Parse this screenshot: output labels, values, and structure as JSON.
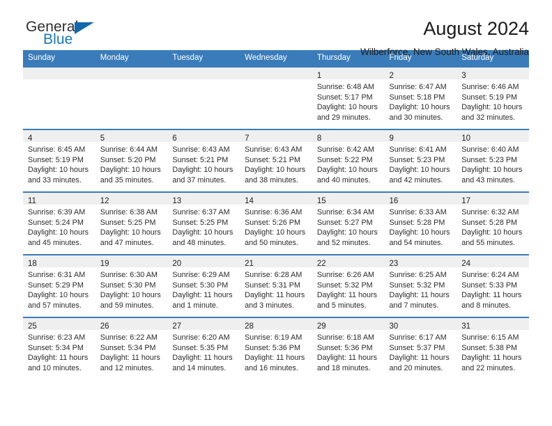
{
  "brand": {
    "name_part1": "General",
    "name_part2": "Blue",
    "accent_color": "#1268ae",
    "text_color": "#2e2e2e"
  },
  "header": {
    "title": "August 2024",
    "subtitle": "Wilberforce, New South Wales, Australia"
  },
  "calendar": {
    "header_bg": "#3a7cba",
    "daynum_bg": "#efefef",
    "weekdays": [
      "Sunday",
      "Monday",
      "Tuesday",
      "Wednesday",
      "Thursday",
      "Friday",
      "Saturday"
    ],
    "weeks": [
      [
        {
          "day": "",
          "sunrise": "",
          "sunset": "",
          "daylight1": "",
          "daylight2": ""
        },
        {
          "day": "",
          "sunrise": "",
          "sunset": "",
          "daylight1": "",
          "daylight2": ""
        },
        {
          "day": "",
          "sunrise": "",
          "sunset": "",
          "daylight1": "",
          "daylight2": ""
        },
        {
          "day": "",
          "sunrise": "",
          "sunset": "",
          "daylight1": "",
          "daylight2": ""
        },
        {
          "day": "1",
          "sunrise": "Sunrise: 6:48 AM",
          "sunset": "Sunset: 5:17 PM",
          "daylight1": "Daylight: 10 hours",
          "daylight2": "and 29 minutes."
        },
        {
          "day": "2",
          "sunrise": "Sunrise: 6:47 AM",
          "sunset": "Sunset: 5:18 PM",
          "daylight1": "Daylight: 10 hours",
          "daylight2": "and 30 minutes."
        },
        {
          "day": "3",
          "sunrise": "Sunrise: 6:46 AM",
          "sunset": "Sunset: 5:19 PM",
          "daylight1": "Daylight: 10 hours",
          "daylight2": "and 32 minutes."
        }
      ],
      [
        {
          "day": "4",
          "sunrise": "Sunrise: 6:45 AM",
          "sunset": "Sunset: 5:19 PM",
          "daylight1": "Daylight: 10 hours",
          "daylight2": "and 33 minutes."
        },
        {
          "day": "5",
          "sunrise": "Sunrise: 6:44 AM",
          "sunset": "Sunset: 5:20 PM",
          "daylight1": "Daylight: 10 hours",
          "daylight2": "and 35 minutes."
        },
        {
          "day": "6",
          "sunrise": "Sunrise: 6:43 AM",
          "sunset": "Sunset: 5:21 PM",
          "daylight1": "Daylight: 10 hours",
          "daylight2": "and 37 minutes."
        },
        {
          "day": "7",
          "sunrise": "Sunrise: 6:43 AM",
          "sunset": "Sunset: 5:21 PM",
          "daylight1": "Daylight: 10 hours",
          "daylight2": "and 38 minutes."
        },
        {
          "day": "8",
          "sunrise": "Sunrise: 6:42 AM",
          "sunset": "Sunset: 5:22 PM",
          "daylight1": "Daylight: 10 hours",
          "daylight2": "and 40 minutes."
        },
        {
          "day": "9",
          "sunrise": "Sunrise: 6:41 AM",
          "sunset": "Sunset: 5:23 PM",
          "daylight1": "Daylight: 10 hours",
          "daylight2": "and 42 minutes."
        },
        {
          "day": "10",
          "sunrise": "Sunrise: 6:40 AM",
          "sunset": "Sunset: 5:23 PM",
          "daylight1": "Daylight: 10 hours",
          "daylight2": "and 43 minutes."
        }
      ],
      [
        {
          "day": "11",
          "sunrise": "Sunrise: 6:39 AM",
          "sunset": "Sunset: 5:24 PM",
          "daylight1": "Daylight: 10 hours",
          "daylight2": "and 45 minutes."
        },
        {
          "day": "12",
          "sunrise": "Sunrise: 6:38 AM",
          "sunset": "Sunset: 5:25 PM",
          "daylight1": "Daylight: 10 hours",
          "daylight2": "and 47 minutes."
        },
        {
          "day": "13",
          "sunrise": "Sunrise: 6:37 AM",
          "sunset": "Sunset: 5:25 PM",
          "daylight1": "Daylight: 10 hours",
          "daylight2": "and 48 minutes."
        },
        {
          "day": "14",
          "sunrise": "Sunrise: 6:36 AM",
          "sunset": "Sunset: 5:26 PM",
          "daylight1": "Daylight: 10 hours",
          "daylight2": "and 50 minutes."
        },
        {
          "day": "15",
          "sunrise": "Sunrise: 6:34 AM",
          "sunset": "Sunset: 5:27 PM",
          "daylight1": "Daylight: 10 hours",
          "daylight2": "and 52 minutes."
        },
        {
          "day": "16",
          "sunrise": "Sunrise: 6:33 AM",
          "sunset": "Sunset: 5:28 PM",
          "daylight1": "Daylight: 10 hours",
          "daylight2": "and 54 minutes."
        },
        {
          "day": "17",
          "sunrise": "Sunrise: 6:32 AM",
          "sunset": "Sunset: 5:28 PM",
          "daylight1": "Daylight: 10 hours",
          "daylight2": "and 55 minutes."
        }
      ],
      [
        {
          "day": "18",
          "sunrise": "Sunrise: 6:31 AM",
          "sunset": "Sunset: 5:29 PM",
          "daylight1": "Daylight: 10 hours",
          "daylight2": "and 57 minutes."
        },
        {
          "day": "19",
          "sunrise": "Sunrise: 6:30 AM",
          "sunset": "Sunset: 5:30 PM",
          "daylight1": "Daylight: 10 hours",
          "daylight2": "and 59 minutes."
        },
        {
          "day": "20",
          "sunrise": "Sunrise: 6:29 AM",
          "sunset": "Sunset: 5:30 PM",
          "daylight1": "Daylight: 11 hours",
          "daylight2": "and 1 minute."
        },
        {
          "day": "21",
          "sunrise": "Sunrise: 6:28 AM",
          "sunset": "Sunset: 5:31 PM",
          "daylight1": "Daylight: 11 hours",
          "daylight2": "and 3 minutes."
        },
        {
          "day": "22",
          "sunrise": "Sunrise: 6:26 AM",
          "sunset": "Sunset: 5:32 PM",
          "daylight1": "Daylight: 11 hours",
          "daylight2": "and 5 minutes."
        },
        {
          "day": "23",
          "sunrise": "Sunrise: 6:25 AM",
          "sunset": "Sunset: 5:32 PM",
          "daylight1": "Daylight: 11 hours",
          "daylight2": "and 7 minutes."
        },
        {
          "day": "24",
          "sunrise": "Sunrise: 6:24 AM",
          "sunset": "Sunset: 5:33 PM",
          "daylight1": "Daylight: 11 hours",
          "daylight2": "and 8 minutes."
        }
      ],
      [
        {
          "day": "25",
          "sunrise": "Sunrise: 6:23 AM",
          "sunset": "Sunset: 5:34 PM",
          "daylight1": "Daylight: 11 hours",
          "daylight2": "and 10 minutes."
        },
        {
          "day": "26",
          "sunrise": "Sunrise: 6:22 AM",
          "sunset": "Sunset: 5:34 PM",
          "daylight1": "Daylight: 11 hours",
          "daylight2": "and 12 minutes."
        },
        {
          "day": "27",
          "sunrise": "Sunrise: 6:20 AM",
          "sunset": "Sunset: 5:35 PM",
          "daylight1": "Daylight: 11 hours",
          "daylight2": "and 14 minutes."
        },
        {
          "day": "28",
          "sunrise": "Sunrise: 6:19 AM",
          "sunset": "Sunset: 5:36 PM",
          "daylight1": "Daylight: 11 hours",
          "daylight2": "and 16 minutes."
        },
        {
          "day": "29",
          "sunrise": "Sunrise: 6:18 AM",
          "sunset": "Sunset: 5:36 PM",
          "daylight1": "Daylight: 11 hours",
          "daylight2": "and 18 minutes."
        },
        {
          "day": "30",
          "sunrise": "Sunrise: 6:17 AM",
          "sunset": "Sunset: 5:37 PM",
          "daylight1": "Daylight: 11 hours",
          "daylight2": "and 20 minutes."
        },
        {
          "day": "31",
          "sunrise": "Sunrise: 6:15 AM",
          "sunset": "Sunset: 5:38 PM",
          "daylight1": "Daylight: 11 hours",
          "daylight2": "and 22 minutes."
        }
      ]
    ]
  }
}
